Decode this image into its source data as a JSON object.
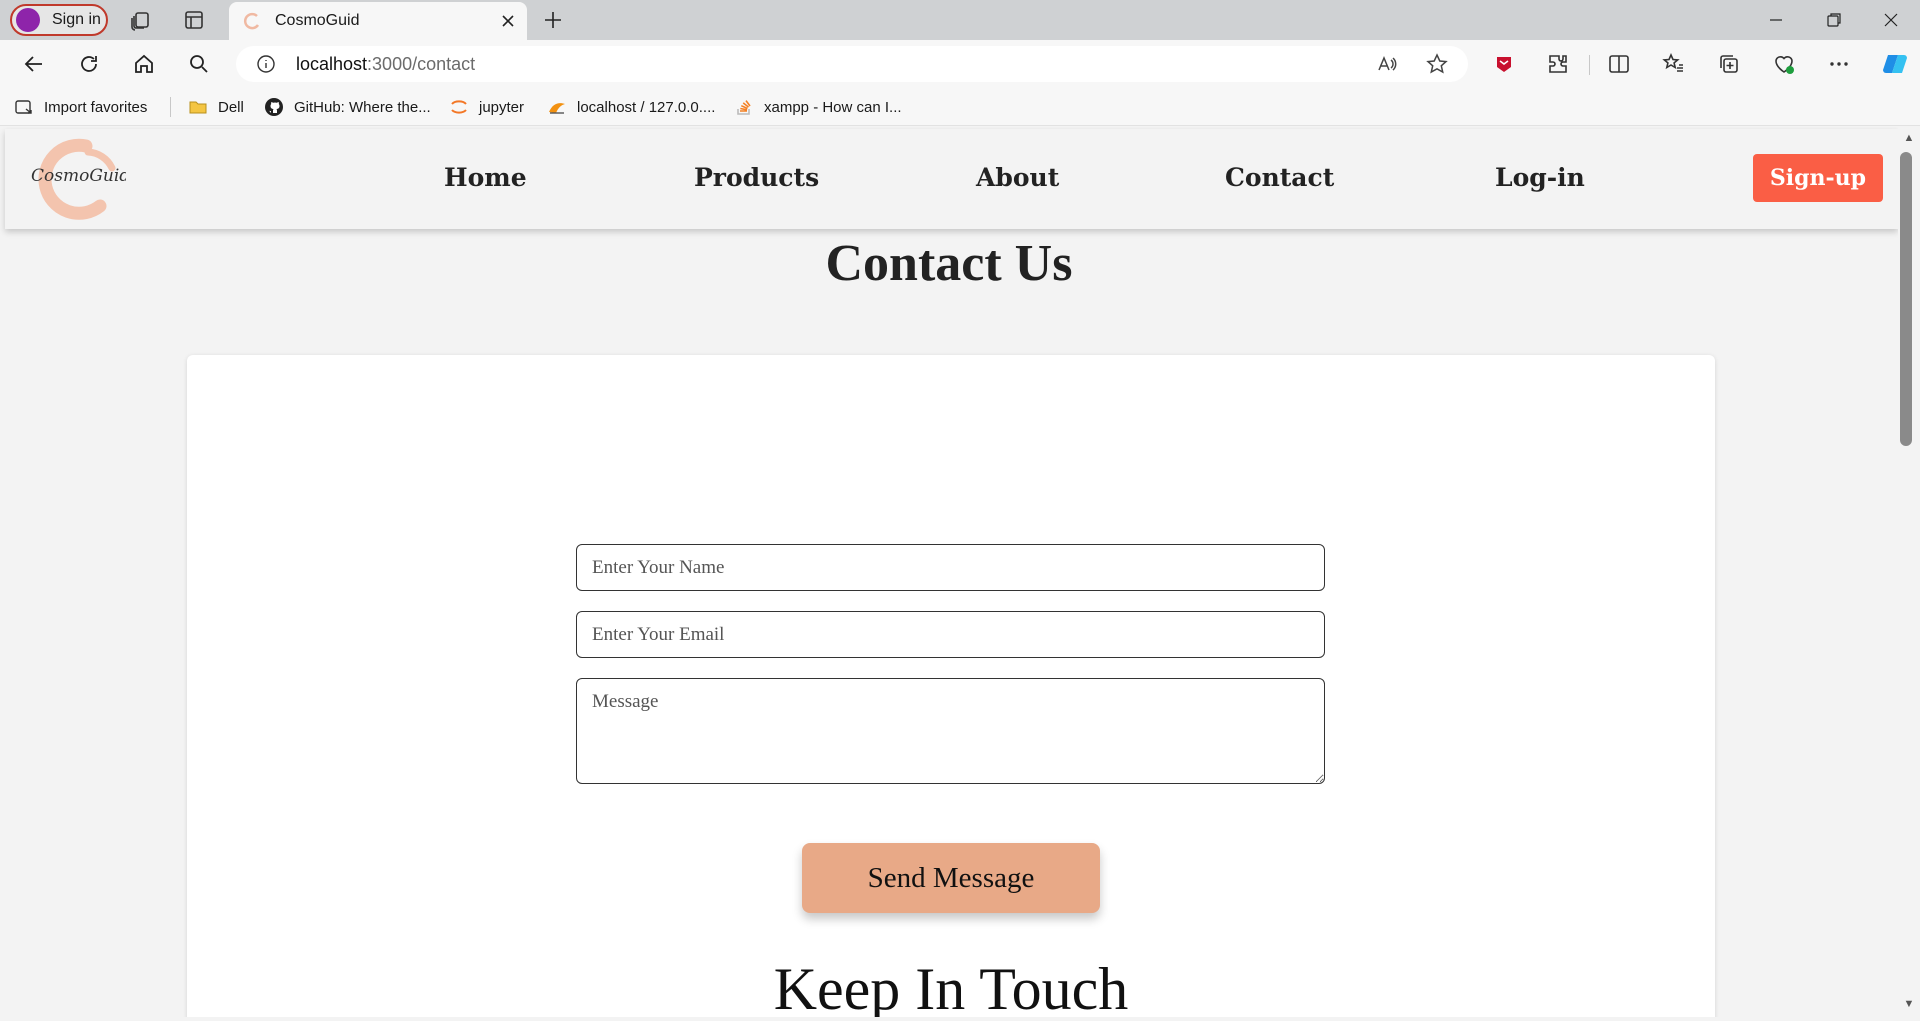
{
  "browser": {
    "profile_label": "Sign in",
    "tab_title": "CosmoGuid",
    "address_host": "localhost",
    "address_path": ":3000/contact",
    "bookmarks": [
      {
        "label": "Import favorites",
        "icon": "import-favorites-icon"
      },
      {
        "label": "Dell",
        "icon": "folder-icon"
      },
      {
        "label": "GitHub: Where the...",
        "icon": "github-icon"
      },
      {
        "label": "jupyter",
        "icon": "jupyter-icon"
      },
      {
        "label": "localhost / 127.0.0....",
        "icon": "phpmyadmin-icon"
      },
      {
        "label": "xampp - How can I...",
        "icon": "stackoverflow-icon"
      }
    ]
  },
  "site": {
    "logo_text": "CosmoGuid",
    "nav": [
      {
        "label": "Home"
      },
      {
        "label": "Products"
      },
      {
        "label": "About"
      },
      {
        "label": "Contact"
      },
      {
        "label": "Log-in"
      }
    ],
    "signup_label": "Sign-up",
    "accent_color": "#fa5e45"
  },
  "contact": {
    "title": "Contact Us",
    "name_placeholder": "Enter Your Name",
    "email_placeholder": "Enter Your Email",
    "message_placeholder": "Message",
    "send_label": "Send Message",
    "button_color": "#e8a987",
    "keep_in_touch": "Keep In Touch"
  }
}
